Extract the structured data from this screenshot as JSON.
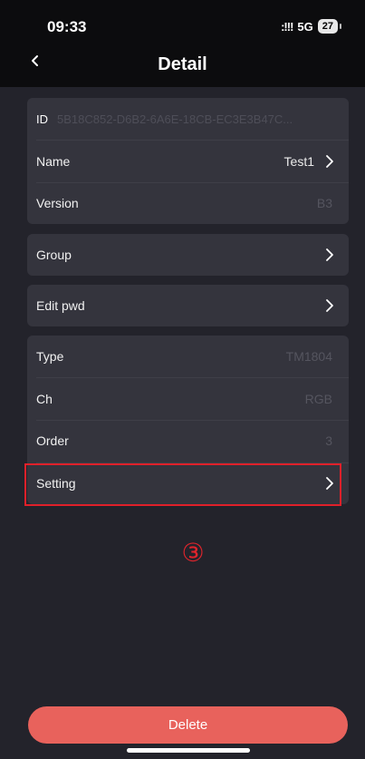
{
  "status": {
    "time": "09:33",
    "signal": ":!!!",
    "network": "5G",
    "battery": "27"
  },
  "nav": {
    "title": "Detail"
  },
  "info": {
    "id_label": "ID",
    "id_value": "5B18C852-D6B2-6A6E-18CB-EC3E3B47C...",
    "name_label": "Name",
    "name_value": "Test1",
    "version_label": "Version",
    "version_value": "B3"
  },
  "group": {
    "label": "Group"
  },
  "edit_pwd": {
    "label": "Edit pwd"
  },
  "specs": {
    "type_label": "Type",
    "type_value": "TM1804",
    "ch_label": "Ch",
    "ch_value": "RGB",
    "order_label": "Order",
    "order_value": "3",
    "setting_label": "Setting"
  },
  "annotation": {
    "marker": "③"
  },
  "actions": {
    "delete_label": "Delete"
  },
  "colors": {
    "accent_delete": "#e8625c",
    "highlight": "#e0202a",
    "background": "#23232b",
    "card": "#34343d"
  }
}
